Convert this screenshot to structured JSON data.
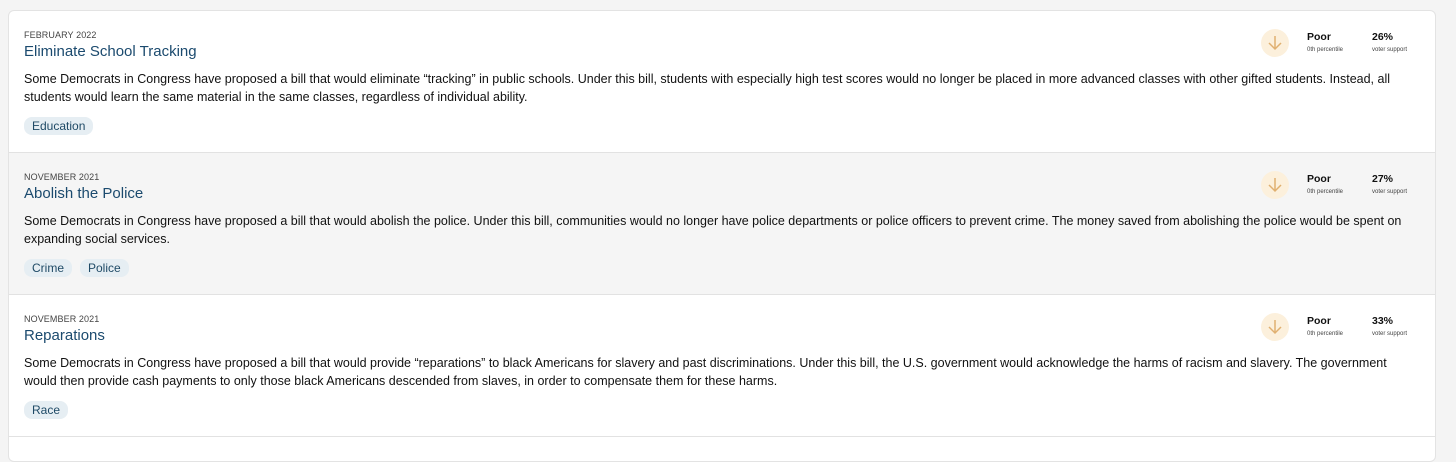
{
  "items": [
    {
      "date": "FEBRUARY 2022",
      "title": "Eliminate School Tracking",
      "description": "Some Democrats in Congress have proposed a bill that would eliminate “tracking” in public schools. Under this bill, students with especially high test scores would no longer be placed in more advanced classes with other gifted students. Instead, all students would learn the same material in the same classes, regardless of individual ability.",
      "tags": [
        "Education"
      ],
      "rating": "Poor",
      "percentile": "0th percentile",
      "support": "26%",
      "support_label": "voter support",
      "trend_icon": "arrow-down-icon"
    },
    {
      "date": "NOVEMBER 2021",
      "title": "Abolish the Police",
      "description": "Some Democrats in Congress have proposed a bill that would abolish the police. Under this bill, communities would no longer have police departments or police officers to prevent crime. The money saved from abolishing the police would be spent on expanding social services.",
      "tags": [
        "Crime",
        "Police"
      ],
      "rating": "Poor",
      "percentile": "0th percentile",
      "support": "27%",
      "support_label": "voter support",
      "trend_icon": "arrow-down-icon"
    },
    {
      "date": "NOVEMBER 2021",
      "title": "Reparations",
      "description": "Some Democrats in Congress have proposed a bill that would provide “reparations” to black Americans for slavery and past discriminations. Under this bill, the U.S. government would acknowledge the harms of racism and slavery. The government would then provide cash payments to only those black Americans descended from slaves, in order to compensate them for these harms.",
      "tags": [
        "Race"
      ],
      "rating": "Poor",
      "percentile": "0th percentile",
      "support": "33%",
      "support_label": "voter support",
      "trend_icon": "arrow-down-icon"
    }
  ],
  "colors": {
    "title": "#1b4a6e",
    "tag_bg": "#e6eef3",
    "icon_bg": "#fcf0dc",
    "icon_stroke": "#e0b070"
  }
}
